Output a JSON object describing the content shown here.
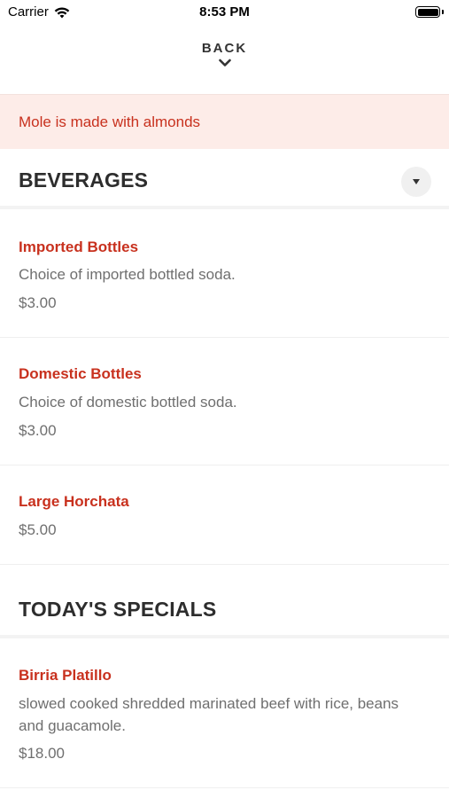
{
  "status_bar": {
    "carrier": "Carrier",
    "time": "8:53 PM"
  },
  "nav": {
    "back_label": "BACK"
  },
  "notice": {
    "text": "Mole is made with almonds"
  },
  "sections": [
    {
      "title": "BEVERAGES",
      "items": [
        {
          "name": "Imported Bottles",
          "description": "Choice of imported bottled soda.",
          "price": "$3.00"
        },
        {
          "name": "Domestic Bottles",
          "description": "Choice of domestic bottled soda.",
          "price": "$3.00"
        },
        {
          "name": "Large Horchata",
          "price": "$5.00"
        }
      ]
    },
    {
      "title": "TODAY'S SPECIALS",
      "items": [
        {
          "name": "Birria Platillo",
          "description": "slowed cooked shredded marinated beef with rice, beans and guacamole.",
          "price": "$18.00"
        }
      ]
    }
  ],
  "colors": {
    "accent": "#c8311e",
    "notice_bg": "#fdece8",
    "muted_text": "#6f6f6f"
  }
}
